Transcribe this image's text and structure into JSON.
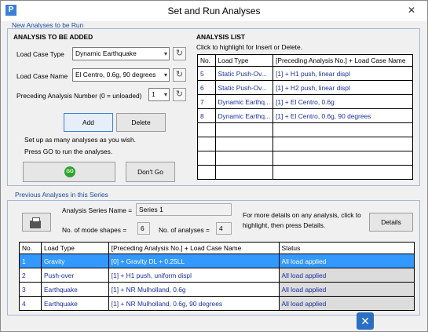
{
  "window": {
    "title": "Set and Run Analyses",
    "app_icon": "P",
    "close": "✕"
  },
  "new_section": {
    "title": "New Analyses to be Run",
    "heading": "ANALYSIS TO BE ADDED",
    "load_case_type_label": "Load Case Type",
    "load_case_type_value": "Dynamic Earthquake",
    "load_case_name_label": "Load Case Name",
    "load_case_name_value": "El Centro, 0.6g, 90 degrees",
    "preceding_label": "Preceding Analysis Number (0 = unloaded)",
    "preceding_value": "1",
    "add_label": "Add",
    "delete_label": "Delete",
    "hint1": "Set up as many analyses as you wish.",
    "hint2": "Press GO to run the analyses.",
    "go_label": "GO",
    "dont_go_label": "Don't Go"
  },
  "analysis_list": {
    "heading": "ANALYSIS LIST",
    "hint": "Click to highlight for Insert or Delete.",
    "columns": [
      "No.",
      "Load Type",
      "[Preceding Analysis No.] + Load Case Name"
    ],
    "rows": [
      [
        "5",
        "Static Push-Ov...",
        "[1] + H1 push, linear displ"
      ],
      [
        "6",
        "Static Push-Ov...",
        "[1] + H2 push, linear displ"
      ],
      [
        "7",
        "Dynamic Earthq...",
        "[1] + El Centro, 0.6g"
      ],
      [
        "8",
        "Dynamic Earthq...",
        "[1] + El Centro, 0.6g, 90 degrees"
      ]
    ]
  },
  "previous_section": {
    "title": "Previous Analyses in this Series",
    "series_name_label": "Analysis Series Name =",
    "series_name_value": "Series 1",
    "mode_shapes_label": "No. of mode shapes =",
    "mode_shapes_value": "6",
    "analyses_label": "No. of analyses =",
    "analyses_value": "4",
    "details_hint1": "For more details on any analysis, click to",
    "details_hint2": "highlight, then press Details.",
    "details_label": "Details",
    "columns": [
      "No.",
      "Load Type",
      "[Preceding Analysis No.] + Load Case Name",
      "Status"
    ],
    "rows": [
      [
        "1",
        "Gravity",
        "[0] + Gravity DL + 0.25LL",
        "All load applied"
      ],
      [
        "2",
        "Push-over",
        "[1] + H1 push, uniform displ",
        "All load applied"
      ],
      [
        "3",
        "Earthquake",
        "[1] + NR Mulholland, 0.6g",
        "All load applied"
      ],
      [
        "4",
        "Earthquake",
        "[1] + NR Mulholland, 0.6g, 90 degrees",
        "All load applied"
      ]
    ]
  },
  "colors": {
    "accent": "#3399ff",
    "section_title": "#1a4a9c",
    "go": "#2da42d"
  },
  "icons": {
    "refresh": "↻",
    "dropdown": "▾",
    "printer": "printer-icon"
  }
}
